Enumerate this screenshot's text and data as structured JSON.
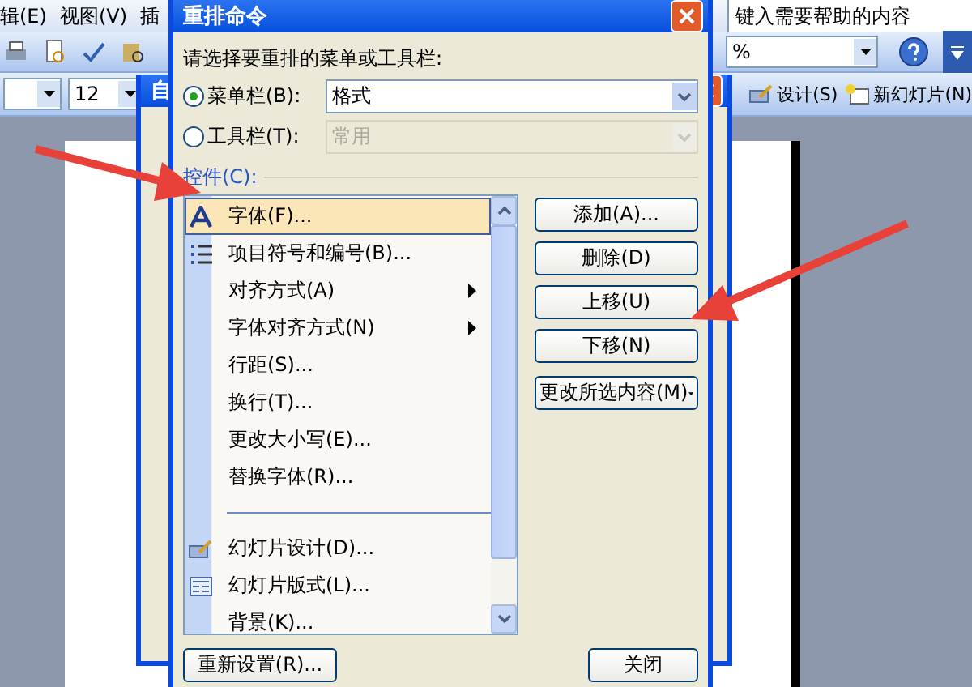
{
  "app": {
    "menu": [
      "辑(E)",
      "视图(V)",
      "插"
    ],
    "help_placeholder": "键入需要帮助的内容",
    "zoom": "%",
    "font_size": "12",
    "toolbar_buttons": [
      "设计(S)",
      "新幻灯片(N)"
    ]
  },
  "customize_dialog": {
    "title": "自"
  },
  "dialog": {
    "title": "重排命令",
    "prompt": "请选择要重排的菜单或工具栏:",
    "options": [
      {
        "label": "菜单栏(B):",
        "selected": true,
        "value": "格式",
        "disabled": false
      },
      {
        "label": "工具栏(T):",
        "selected": false,
        "value": "常用",
        "disabled": true
      }
    ],
    "controls_label": "控件(C):",
    "commands": [
      {
        "kind": "command",
        "label": "字体(F)...",
        "submenu": false,
        "selected": true
      },
      {
        "kind": "command",
        "label": "项目符号和编号(B)...",
        "submenu": false,
        "selected": false
      },
      {
        "kind": "command",
        "label": "对齐方式(A)",
        "submenu": true,
        "selected": false
      },
      {
        "kind": "command",
        "label": "字体对齐方式(N)",
        "submenu": true,
        "selected": false
      },
      {
        "kind": "command",
        "label": "行距(S)...",
        "submenu": false,
        "selected": false
      },
      {
        "kind": "command",
        "label": "换行(T)...",
        "submenu": false,
        "selected": false
      },
      {
        "kind": "command",
        "label": "更改大小写(E)...",
        "submenu": false,
        "selected": false
      },
      {
        "kind": "command",
        "label": "替换字体(R)...",
        "submenu": false,
        "selected": false
      },
      {
        "kind": "separator"
      },
      {
        "kind": "command",
        "label": "幻灯片设计(D)...",
        "submenu": false,
        "selected": false
      },
      {
        "kind": "command",
        "label": "幻灯片版式(L)...",
        "submenu": false,
        "selected": false
      },
      {
        "kind": "command",
        "label": "背景(K)...",
        "submenu": false,
        "selected": false
      }
    ],
    "side_buttons": [
      {
        "kind": "button",
        "label": "添加(A)..."
      },
      {
        "kind": "button",
        "label": "删除(D)"
      },
      {
        "kind": "button",
        "label": "上移(U)"
      },
      {
        "kind": "button",
        "label": "下移(N)"
      },
      {
        "kind": "dropdown",
        "label": "更改所选内容(M)"
      }
    ],
    "reset_button": "重新设置(R)...",
    "close_button": "关闭"
  }
}
